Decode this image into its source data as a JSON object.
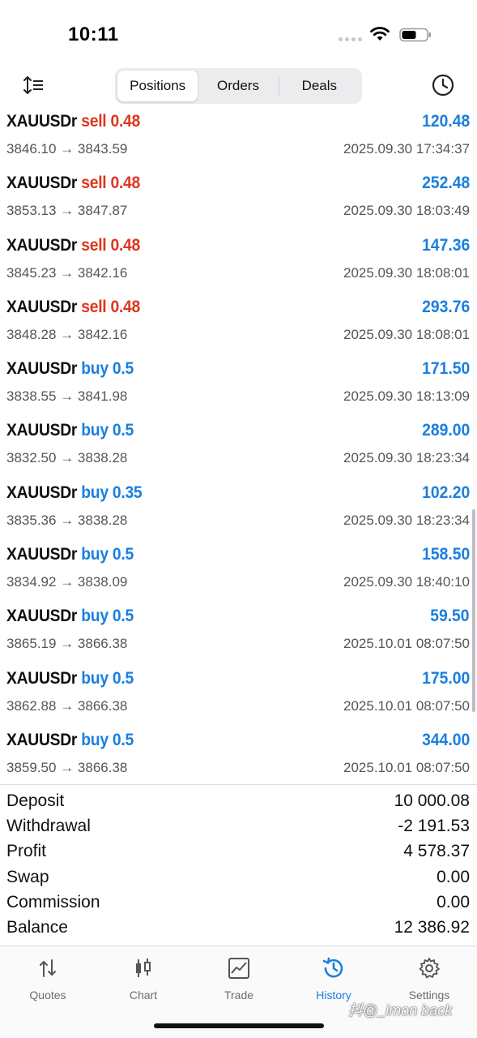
{
  "status_bar": {
    "time": "10:11"
  },
  "toolbar": {
    "segments": [
      "Positions",
      "Orders",
      "Deals"
    ],
    "active_segment": "Positions"
  },
  "deals": [
    {
      "symbol": "XAUUSDr",
      "side": "sell",
      "volume": "0.48",
      "open_price": "3846.10",
      "close_price": "3843.59",
      "time": "2025.09.30 17:34:37",
      "profit": "120.48"
    },
    {
      "symbol": "XAUUSDr",
      "side": "sell",
      "volume": "0.48",
      "open_price": "3853.13",
      "close_price": "3847.87",
      "time": "2025.09.30 18:03:49",
      "profit": "252.48"
    },
    {
      "symbol": "XAUUSDr",
      "side": "sell",
      "volume": "0.48",
      "open_price": "3845.23",
      "close_price": "3842.16",
      "time": "2025.09.30 18:08:01",
      "profit": "147.36"
    },
    {
      "symbol": "XAUUSDr",
      "side": "sell",
      "volume": "0.48",
      "open_price": "3848.28",
      "close_price": "3842.16",
      "time": "2025.09.30 18:08:01",
      "profit": "293.76"
    },
    {
      "symbol": "XAUUSDr",
      "side": "buy",
      "volume": "0.5",
      "open_price": "3838.55",
      "close_price": "3841.98",
      "time": "2025.09.30 18:13:09",
      "profit": "171.50"
    },
    {
      "symbol": "XAUUSDr",
      "side": "buy",
      "volume": "0.5",
      "open_price": "3832.50",
      "close_price": "3838.28",
      "time": "2025.09.30 18:23:34",
      "profit": "289.00"
    },
    {
      "symbol": "XAUUSDr",
      "side": "buy",
      "volume": "0.35",
      "open_price": "3835.36",
      "close_price": "3838.28",
      "time": "2025.09.30 18:23:34",
      "profit": "102.20"
    },
    {
      "symbol": "XAUUSDr",
      "side": "buy",
      "volume": "0.5",
      "open_price": "3834.92",
      "close_price": "3838.09",
      "time": "2025.09.30 18:40:10",
      "profit": "158.50"
    },
    {
      "symbol": "XAUUSDr",
      "side": "buy",
      "volume": "0.5",
      "open_price": "3865.19",
      "close_price": "3866.38",
      "time": "2025.10.01 08:07:50",
      "profit": "59.50"
    },
    {
      "symbol": "XAUUSDr",
      "side": "buy",
      "volume": "0.5",
      "open_price": "3862.88",
      "close_price": "3866.38",
      "time": "2025.10.01 08:07:50",
      "profit": "175.00"
    },
    {
      "symbol": "XAUUSDr",
      "side": "buy",
      "volume": "0.5",
      "open_price": "3859.50",
      "close_price": "3866.38",
      "time": "2025.10.01 08:07:50",
      "profit": "344.00"
    }
  ],
  "summary": [
    {
      "label": "Deposit",
      "value": "10 000.08"
    },
    {
      "label": "Withdrawal",
      "value": "-2 191.53"
    },
    {
      "label": "Profit",
      "value": "4 578.37"
    },
    {
      "label": "Swap",
      "value": "0.00"
    },
    {
      "label": "Commission",
      "value": "0.00"
    },
    {
      "label": "Balance",
      "value": "12 386.92"
    }
  ],
  "tabbar": {
    "tabs": [
      {
        "label": "Quotes",
        "icon": "quotes-icon"
      },
      {
        "label": "Chart",
        "icon": "chart-icon"
      },
      {
        "label": "Trade",
        "icon": "trade-icon"
      },
      {
        "label": "History",
        "icon": "history-icon"
      },
      {
        "label": "Settings",
        "icon": "settings-icon"
      }
    ],
    "active_tab": "History"
  },
  "watermark": "抖@_imon back",
  "colors": {
    "accent_blue": "#1a7fe0",
    "sell_red": "#e0341e",
    "buy_blue": "#1a7fe0"
  }
}
